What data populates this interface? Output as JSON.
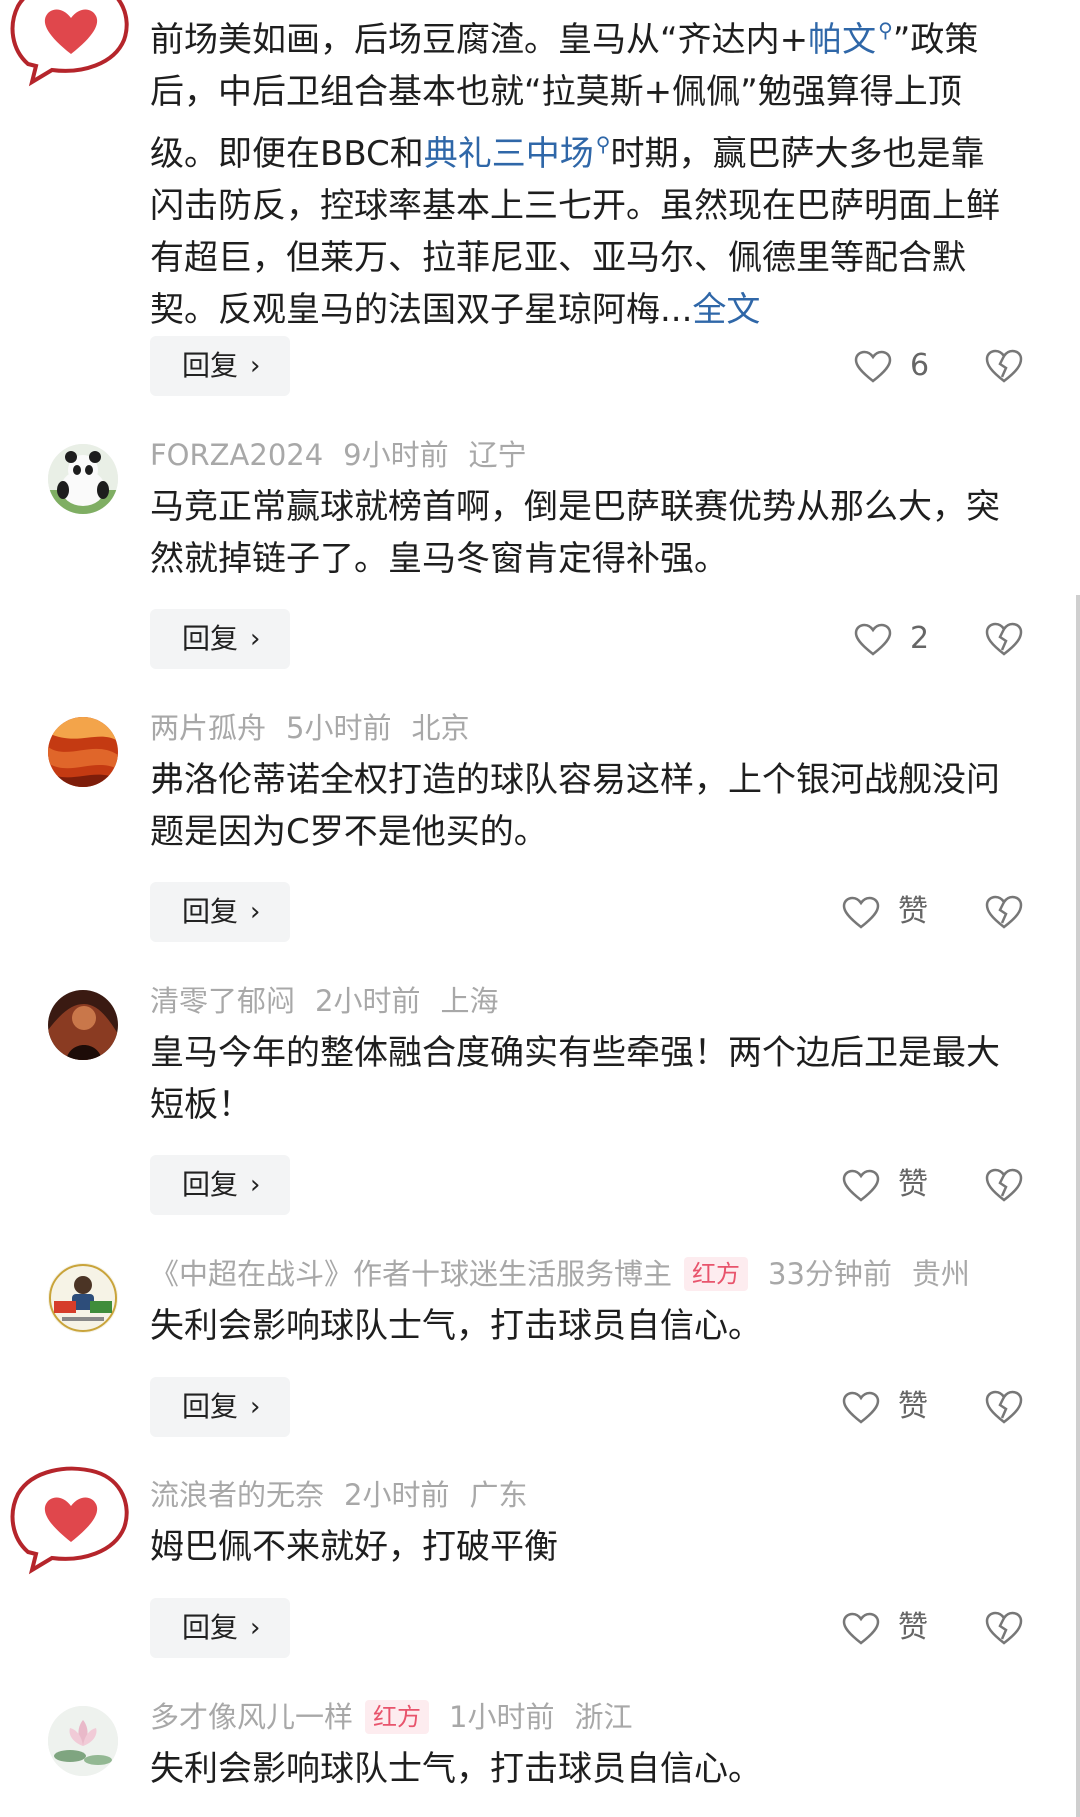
{
  "comments": [
    {
      "avatar": "heart-speech-bubble-icon",
      "text_lines": [
        [
          "前场美如画，后场豆腐渣。皇马从“齐达内+",
          "帕文",
          "”政策"
        ],
        [
          "后，中后卫组合基本也就“拉莫斯+佩佩”勉强算得上顶"
        ],
        [
          "级。即便在BBC和",
          "典礼三中场",
          "时期，赢巴萨大多也是靠"
        ],
        [
          "闪击防反，控球率基本上三七开。虽然现在巴萨明面上鲜"
        ],
        [
          "有超巨，但莱万、拉菲尼亚、亚马尔、佩德里等配合默"
        ],
        [
          "契。反观皇马的法国双子星琼阿梅...",
          "全文"
        ]
      ],
      "reply_label": "回复",
      "like_text": "6"
    },
    {
      "author": "FORZA2024",
      "time": "9小时前",
      "location": "辽宁",
      "avatar": "panda-avatar",
      "text_lines": [
        "马竞正常赢球就榜首啊，倒是巴萨联赛优势从那么大，突",
        "然就掉链子了。皇马冬窗肯定得补强。"
      ],
      "reply_label": "回复",
      "like_text": "2"
    },
    {
      "author": "两片孤舟",
      "time": "5小时前",
      "location": "北京",
      "avatar": "red-rock-avatar",
      "text_lines": [
        "弗洛伦蒂诺全权打造的球队容易这样，上个银河战舰没问",
        "题是因为C罗不是他买的。"
      ],
      "reply_label": "回复",
      "like_text": "赞"
    },
    {
      "author": "清零了郁闷",
      "time": "2小时前",
      "location": "上海",
      "avatar": "dark-portrait-avatar",
      "text_lines": [
        "皇马今年的整体融合度确实有些牵强！两个边后卫是最大",
        "短板！"
      ],
      "reply_label": "回复",
      "like_text": "赞"
    },
    {
      "author": "《中超在战斗》作者十球迷生活服务博主",
      "badge": "红方",
      "time": "33分钟前",
      "location": "贵州",
      "avatar": "blogger-badge-avatar",
      "text_lines": [
        "失利会影响球队士气，打击球员自信心。"
      ],
      "reply_label": "回复",
      "like_text": "赞"
    },
    {
      "author": "流浪者的无奈",
      "time": "2小时前",
      "location": "广东",
      "avatar": "heart-speech-bubble-icon",
      "text_lines": [
        "姆巴佩不来就好，打破平衡"
      ],
      "reply_label": "回复",
      "like_text": "赞"
    },
    {
      "author": "多才像风儿一样",
      "badge": "红方",
      "time": "1小时前",
      "location": "浙江",
      "avatar": "lotus-avatar",
      "text_lines": [
        "失利会影响球队士气，打击球员自信心。"
      ]
    }
  ],
  "colors": {
    "link": "#2f67a8",
    "meta": "#a8a8a8",
    "badge_bg": "#fdecef",
    "badge_text": "#e8546c",
    "heart": "#e0474c"
  }
}
